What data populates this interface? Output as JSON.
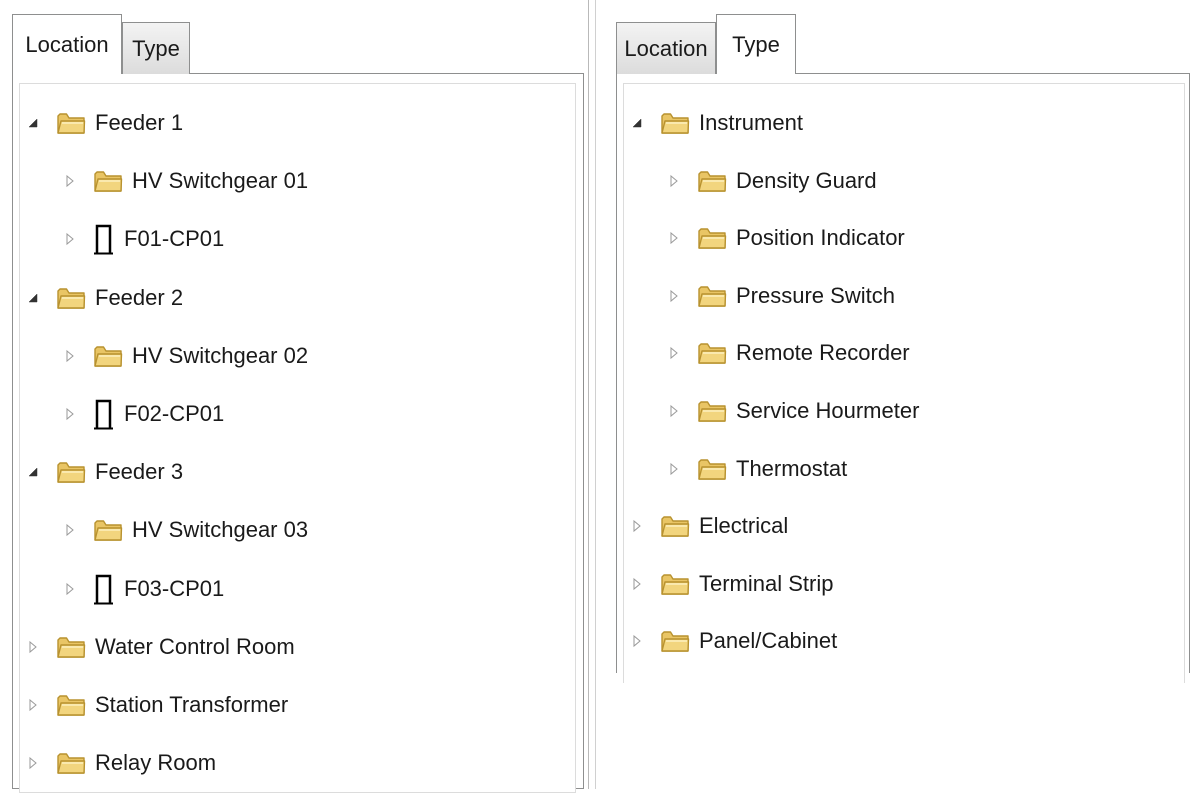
{
  "left": {
    "tabs": [
      {
        "label": "Location",
        "active": true
      },
      {
        "label": "Type",
        "active": false
      }
    ],
    "tree": [
      {
        "label": "Feeder 1",
        "icon": "folder-icon",
        "expander": "expanded",
        "level": 0
      },
      {
        "label": "HV Switchgear 01",
        "icon": "folder-icon",
        "expander": "collapsed",
        "level": 1
      },
      {
        "label": "F01-CP01",
        "icon": "panel-icon",
        "expander": "collapsed",
        "level": 1
      },
      {
        "label": "Feeder 2",
        "icon": "folder-icon",
        "expander": "expanded",
        "level": 0
      },
      {
        "label": "HV Switchgear 02",
        "icon": "folder-icon",
        "expander": "collapsed",
        "level": 1
      },
      {
        "label": "F02-CP01",
        "icon": "panel-icon",
        "expander": "collapsed",
        "level": 1
      },
      {
        "label": "Feeder 3",
        "icon": "folder-icon",
        "expander": "expanded",
        "level": 0
      },
      {
        "label": "HV Switchgear 03",
        "icon": "folder-icon",
        "expander": "collapsed",
        "level": 1
      },
      {
        "label": "F03-CP01",
        "icon": "panel-icon",
        "expander": "collapsed",
        "level": 1
      },
      {
        "label": "Water Control Room",
        "icon": "folder-icon",
        "expander": "collapsed",
        "level": 0
      },
      {
        "label": "Station Transformer",
        "icon": "folder-icon",
        "expander": "collapsed",
        "level": 0
      },
      {
        "label": "Relay Room",
        "icon": "folder-icon",
        "expander": "collapsed",
        "level": 0
      }
    ]
  },
  "right": {
    "tabs": [
      {
        "label": "Location",
        "active": false
      },
      {
        "label": "Type",
        "active": true
      }
    ],
    "tree": [
      {
        "label": "Instrument",
        "icon": "folder-icon",
        "expander": "expanded",
        "level": 0
      },
      {
        "label": "Density Guard",
        "icon": "folder-icon",
        "expander": "collapsed",
        "level": 1
      },
      {
        "label": "Position Indicator",
        "icon": "folder-icon",
        "expander": "collapsed",
        "level": 1
      },
      {
        "label": "Pressure Switch",
        "icon": "folder-icon",
        "expander": "collapsed",
        "level": 1
      },
      {
        "label": "Remote Recorder",
        "icon": "folder-icon",
        "expander": "collapsed",
        "level": 1
      },
      {
        "label": "Service Hourmeter",
        "icon": "folder-icon",
        "expander": "collapsed",
        "level": 1
      },
      {
        "label": "Thermostat",
        "icon": "folder-icon",
        "expander": "collapsed",
        "level": 1
      },
      {
        "label": "Electrical",
        "icon": "folder-icon",
        "expander": "collapsed",
        "level": 0
      },
      {
        "label": "Terminal Strip",
        "icon": "folder-icon",
        "expander": "collapsed",
        "level": 0
      },
      {
        "label": "Panel/Cabinet",
        "icon": "folder-icon",
        "expander": "collapsed",
        "level": 0
      }
    ]
  },
  "colors": {
    "folder_fill": "#f2d57e",
    "folder_stroke": "#b8922f",
    "tab_border": "#8e8f8f",
    "expander": "#9a9a9a",
    "text": "#1a1a1a"
  }
}
